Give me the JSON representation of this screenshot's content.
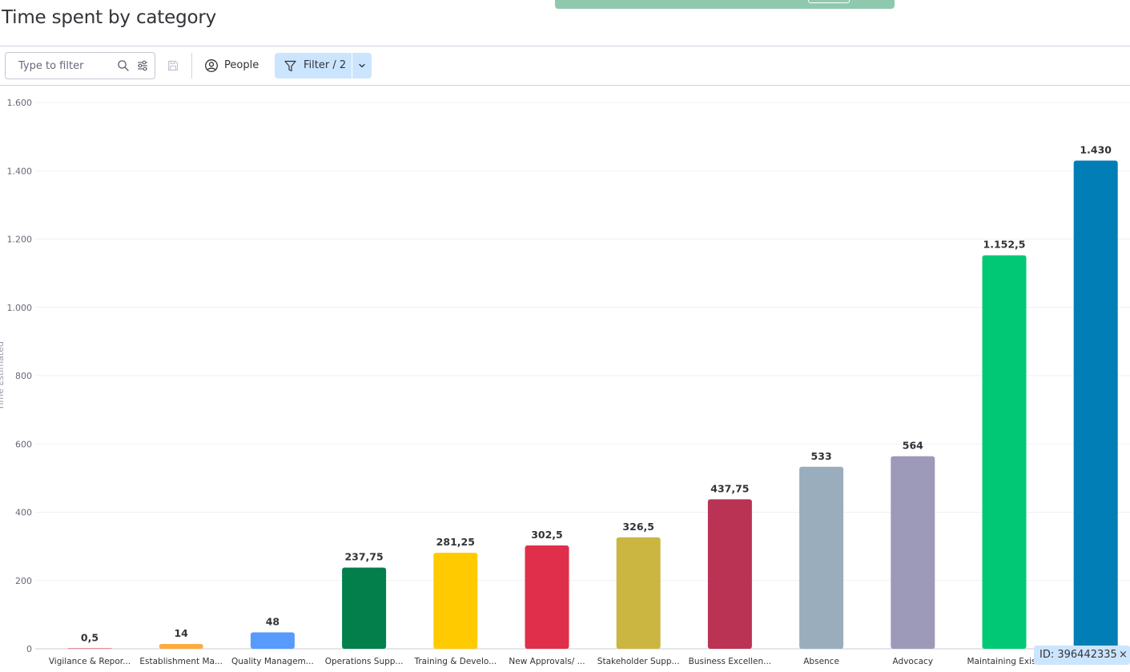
{
  "page": {
    "title": "Time spent by category"
  },
  "toolbar": {
    "search_placeholder": "Type to filter",
    "people_label": "People",
    "filter_label": "Filter / 2"
  },
  "badge": {
    "id_text": "ID: 396442335",
    "close_symbol": "×"
  },
  "colors": {
    "accent_selected": "#cce5ff",
    "toast": "#8ec9ae"
  },
  "chart_data": {
    "type": "bar",
    "categories": [
      "Vigilance & Repor...",
      "Establishment Ma...",
      "Quality Managem...",
      "Operations Supp...",
      "Training & Develo...",
      "New Approvals/ ...",
      "Stakeholder Supp...",
      "Business Excellen...",
      "Absence",
      "Advocacy",
      "Maintaining Existi",
      ""
    ],
    "values": [
      0.5,
      14,
      48,
      237.75,
      281.25,
      302.5,
      326.5,
      437.75,
      533,
      564,
      1152.5,
      1430
    ],
    "value_labels": [
      "0,5",
      "14",
      "48",
      "237,75",
      "281,25",
      "302,5",
      "326,5",
      "437,75",
      "533",
      "564",
      "1.152,5",
      "1.430"
    ],
    "colors": [
      "#e2445c",
      "#fdab3d",
      "#579bfc",
      "#037f4c",
      "#ffcb00",
      "#df2f4a",
      "#cab641",
      "#bb3354",
      "#9aadbd",
      "#9d99b9",
      "#00c875",
      "#007eb5"
    ],
    "ylim": [
      0,
      1600
    ],
    "y_ticks": [
      0,
      200,
      400,
      600,
      800,
      1000,
      1200,
      1400,
      1600
    ],
    "y_tick_labels": [
      "0",
      "200",
      "400",
      "600",
      "800",
      "1.000",
      "1.200",
      "1.400",
      "1.600"
    ],
    "ylabel": "Time Estimated",
    "grid": true
  }
}
